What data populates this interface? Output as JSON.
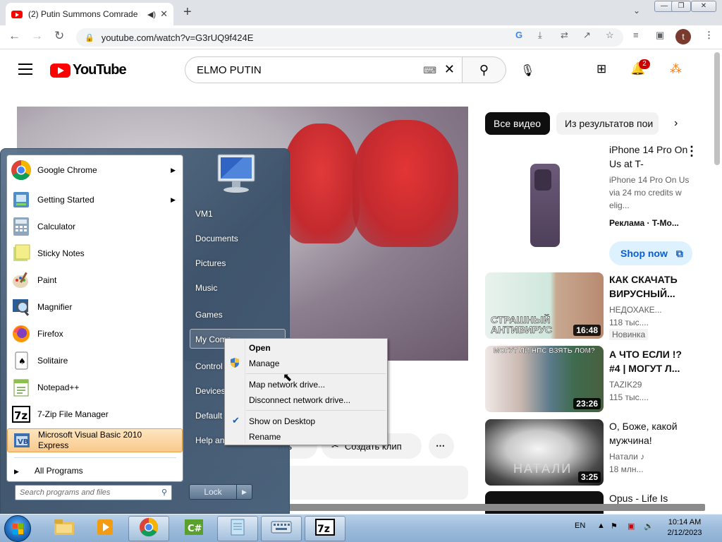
{
  "browser": {
    "tab_title": "(2) Putin Summons Comrade",
    "url": "youtube.com/watch?v=G3rUQ9f424E",
    "profile_initial": "t"
  },
  "youtube": {
    "logo_text": "YouTube",
    "search_value": "ELMO PUTIN",
    "notification_count": "2",
    "chips": [
      "Все видео",
      "Из результатов пои"
    ],
    "below_video_buttons": [
      "ить",
      "Создать клип"
    ],
    "recommendations": [
      {
        "title": "iPhone 14 Pro On Us at T-",
        "sub1": "iPhone 14 Pro On Us via 24 mo credits w elig...",
        "sub2": "Реклама · T-Mo...",
        "button": "Shop now"
      },
      {
        "title": "КАК СКАЧАТЬ ВИРУСНЫЙ...",
        "channel": "НЕДОХАКЕ...",
        "views": "118 тыс....",
        "badge": "Новинка",
        "duration": "16:48",
        "thumb_text": "СТРАШНЫЙ АНТИВИРУС"
      },
      {
        "title": "А ЧТО ЕСЛИ !? #4 | МОГУТ Л...",
        "channel": "TAZIK29",
        "views": "115 тыс....",
        "duration": "23:26",
        "thumb_text": "МОГУТ ЛИ НПС ВЗЯТЬ ЛОМ?"
      },
      {
        "title": "О, Боже, какой мужчина!",
        "channel": "Натали ♪",
        "views": "18 млн...",
        "duration": "3:25",
        "thumb_text": "НАТАЛИ"
      },
      {
        "title": "Opus - Life Is"
      }
    ]
  },
  "startmenu": {
    "programs": [
      {
        "label": "Google Chrome",
        "icon": "chrome-icon",
        "arrow": true
      },
      {
        "label": "Getting Started",
        "icon": "getting-started-icon",
        "arrow": true
      },
      {
        "label": "Calculator",
        "icon": "calculator-icon"
      },
      {
        "label": "Sticky Notes",
        "icon": "sticky-notes-icon"
      },
      {
        "label": "Paint",
        "icon": "paint-icon"
      },
      {
        "label": "Magnifier",
        "icon": "magnifier-icon"
      },
      {
        "label": "Firefox",
        "icon": "firefox-icon"
      },
      {
        "label": "Solitaire",
        "icon": "solitaire-icon"
      },
      {
        "label": "Notepad++",
        "icon": "notepadpp-icon"
      },
      {
        "label": "7-Zip File Manager",
        "icon": "7zip-icon"
      },
      {
        "label": "Microsoft Visual Basic 2010 Express",
        "icon": "vb-icon"
      }
    ],
    "all_programs": "All Programs",
    "search_placeholder": "Search programs and files",
    "right_links": [
      "VM1",
      "Documents",
      "Pictures",
      "Music",
      "Games",
      "My Comp",
      "Control",
      "Devices",
      "Default",
      "Help an"
    ],
    "lock_label": "Lock"
  },
  "context_menu": {
    "items": [
      "Open",
      "Manage",
      "Map network drive...",
      "Disconnect network drive...",
      "Show on Desktop",
      "Rename"
    ]
  },
  "taskbar": {
    "language": "EN",
    "time": "10:14 AM",
    "date": "2/12/2023"
  }
}
